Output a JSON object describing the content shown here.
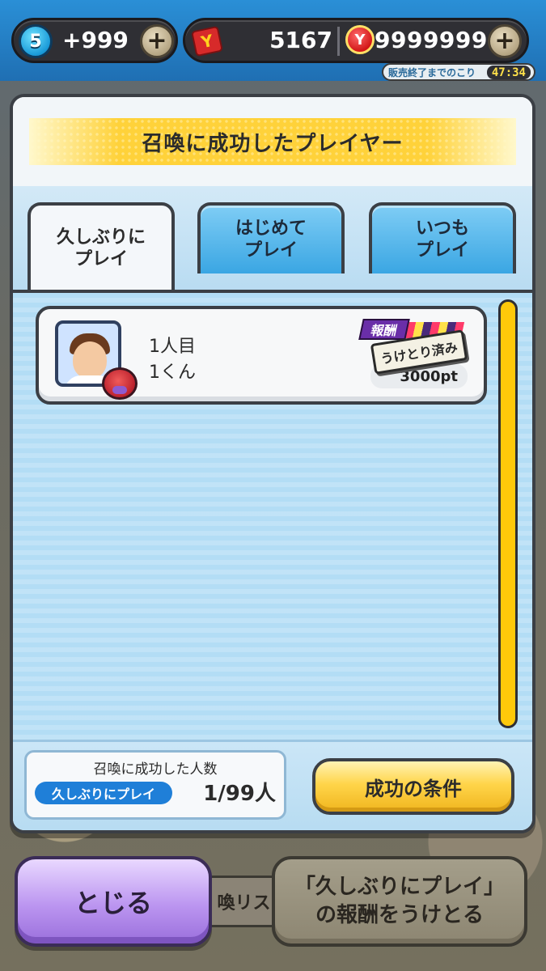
{
  "status_bar": {
    "stamina_level": "5",
    "stamina_value": "+999",
    "ticket_icon_label": "Y",
    "ticket_value": "5167",
    "money_icon_label": "Y",
    "money_value": "9999999",
    "sale_label": "販売終了までのこり",
    "sale_timer": "47:34"
  },
  "modal": {
    "title": "召喚に成功したプレイヤー",
    "tabs": [
      {
        "label": "久しぶりに\nプレイ",
        "active": true
      },
      {
        "label": "はじめて\nプレイ",
        "active": false
      },
      {
        "label": "いつも\nプレイ",
        "active": false
      }
    ],
    "players": [
      {
        "rank": "1人目",
        "name": "1くん",
        "reward_tag": "報酬",
        "reward_value": "3000pt",
        "status_stamp": "うけとり済み"
      }
    ],
    "footer": {
      "count_label": "召喚に成功した人数",
      "count_category": "久しぶりにプレイ",
      "count_value": "1/99人",
      "conditions_button": "成功の条件"
    }
  },
  "bottom": {
    "close_button": "とじる",
    "summon_list_partial": "喚リス",
    "receive_button": "「久しぶりにプレイ」\nの報酬をうけとる"
  },
  "colors": {
    "accent_yellow": "#ffd23a",
    "tab_blue": "#3aa6e3",
    "close_purple": "#bb95f0",
    "count_chip_blue": "#1f7fd8"
  }
}
